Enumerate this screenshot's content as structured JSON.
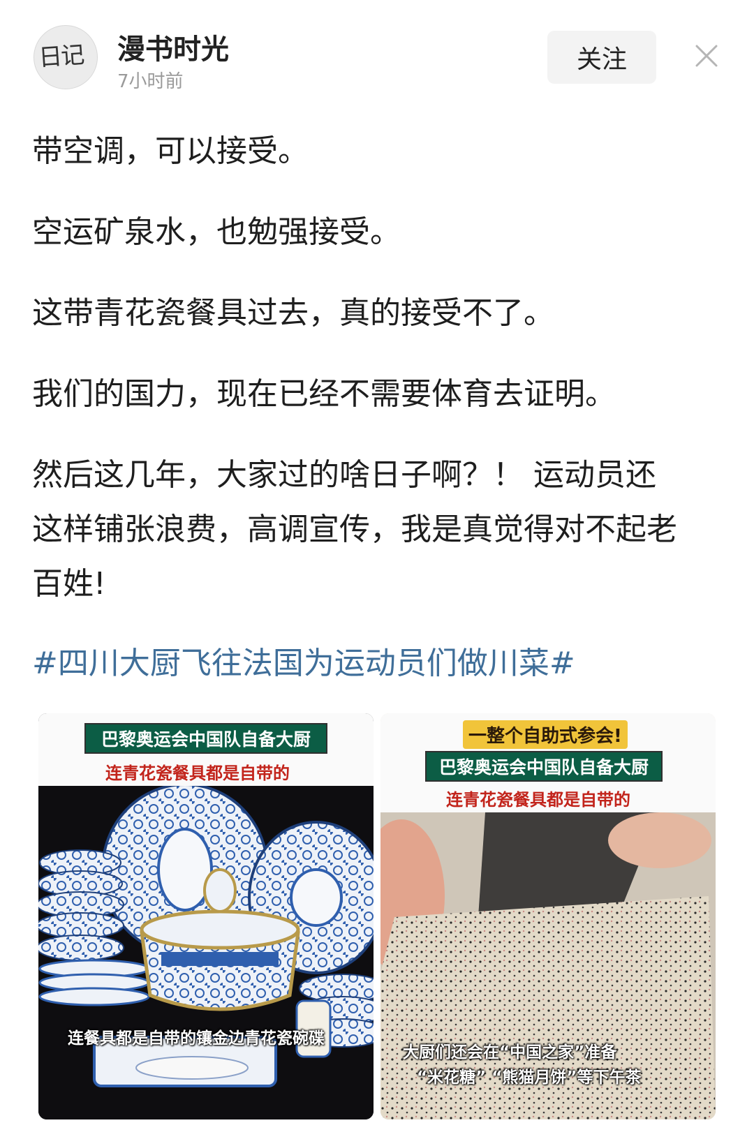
{
  "header": {
    "author_name": "漫书时光",
    "post_time": "7小时前",
    "follow_label": "关注",
    "avatar_text": "日记"
  },
  "post": {
    "paragraphs": [
      "带空调，可以接受。",
      "空运矿泉水，也勉强接受。",
      "这带青花瓷餐具过去，真的接受不了。",
      "我们的国力，现在已经不需要体育去证明。",
      "然后这几年，大家过的啥日子啊？！ 运动员还这样铺张浪费，高调宣传，我是真觉得对不起老百姓!"
    ],
    "hashtag": "#四川大厨飞往法国为运动员们做川菜#"
  },
  "images": {
    "left": {
      "title": "巴黎奥运会中国队自备大厨",
      "subtitle": "连青花瓷餐具都是自带的",
      "caption": "连餐具都是自带的镶金边青花瓷碗碟"
    },
    "right": {
      "top_banner": "一整个自助式参会!",
      "title": "巴黎奥运会中国队自备大厨",
      "subtitle": "连青花瓷餐具都是自带的",
      "caption_line1": "大厨们还会在“中国之家”准备",
      "caption_line2": "“米花糖” “熊猫月饼”等下午茶"
    }
  },
  "colors": {
    "hashtag": "#3f6e99",
    "title_band_green": "#0c5d45",
    "subtitle_red": "#c2241b",
    "porcelain_blue": "#2f5fae"
  },
  "icons": {
    "close": "close-icon"
  }
}
